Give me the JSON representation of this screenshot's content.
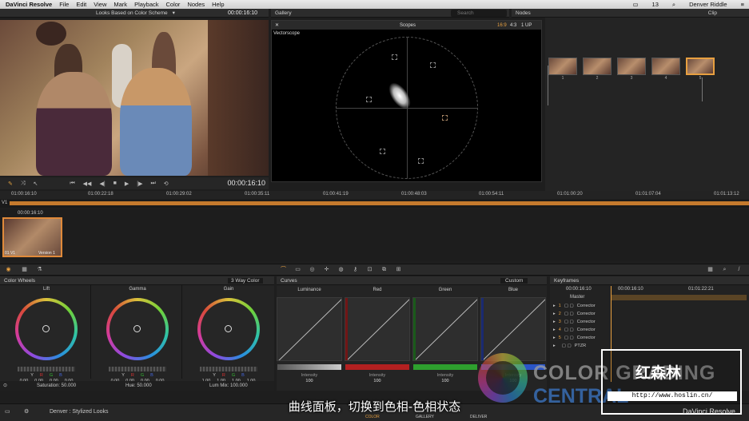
{
  "menubar": {
    "app": "DaVinci Resolve",
    "items": [
      "File",
      "Edit",
      "View",
      "Mark",
      "Playback",
      "Color",
      "Nodes",
      "Help"
    ],
    "battery": "13",
    "user": "Denver Riddle"
  },
  "viewer": {
    "selector": "Looks Based on Color Scheme",
    "timecode_top": "00:00:16:10",
    "timecode_bottom": "00:00:16:10"
  },
  "gallery": {
    "title": "Gallery",
    "search_placeholder": "Search"
  },
  "nodes_panel": {
    "title": "Nodes",
    "clip_label": "Clip",
    "node_labels": [
      "1",
      "2",
      "3",
      "4",
      "5"
    ]
  },
  "scopes": {
    "title": "Scopes",
    "ratio_169": "16:9",
    "ratio_43": "4:3",
    "layout": "1 UP",
    "scope_name": "Vectorscope"
  },
  "ruler": {
    "ticks": [
      "01:00:16:10",
      "01:00:22:18",
      "01:00:29:02",
      "01:00:35:11",
      "01:00:41:19",
      "01:00:48:03",
      "01:00:54:11",
      "01:01:00:20",
      "01:01:07:04",
      "01:01:13:12"
    ],
    "track": "V1"
  },
  "clip": {
    "timecode": "00:00:16:10",
    "label": "01 V1",
    "version": "Version 1"
  },
  "color_wheels": {
    "title": "Color Wheels",
    "mode": "3 Way Color",
    "wheels": [
      {
        "name": "Lift",
        "values": [
          "0.00",
          "0.00",
          "0.00",
          "0.00"
        ]
      },
      {
        "name": "Gamma",
        "values": [
          "0.00",
          "0.00",
          "0.00",
          "0.00"
        ]
      },
      {
        "name": "Gain",
        "values": [
          "1.00",
          "1.00",
          "1.00",
          "1.00"
        ]
      }
    ],
    "channels": [
      "Y",
      "R",
      "G",
      "B"
    ],
    "saturation": "Saturation: 50.000",
    "hue": "Hue: 50.000",
    "lum_mix": "Lum Mix: 100.000"
  },
  "curves": {
    "title": "Curves",
    "mode": "Custom",
    "channels": [
      {
        "name": "Luminance",
        "intensity": "100",
        "color": "#8a8a8a"
      },
      {
        "name": "Red",
        "intensity": "100",
        "color": "#b32020"
      },
      {
        "name": "Green",
        "intensity": "100",
        "color": "#2ea02e"
      },
      {
        "name": "Blue",
        "intensity": "100",
        "color": "#2a55c8"
      }
    ],
    "intensity_label": "Intensity"
  },
  "keyframes": {
    "title": "Keyframes",
    "tc_left": "00:00:16:10",
    "tc_mid": "00:00:16:10",
    "tc_right": "01:01:22:21",
    "master": "Master",
    "rows": [
      {
        "num": "1",
        "label": "Corrector"
      },
      {
        "num": "2",
        "label": "Corrector"
      },
      {
        "num": "3",
        "label": "Corrector"
      },
      {
        "num": "4",
        "label": "Corrector"
      },
      {
        "num": "5",
        "label": "Corrector"
      },
      {
        "num": "",
        "label": "PTZR"
      }
    ]
  },
  "bottombar": {
    "project": "Denver : Stylized Looks",
    "tab_color": "COLOR",
    "tab_gallery": "GALLERY",
    "tab_deliver": "DELIVER"
  },
  "subtitle": "曲线面板，切换到色相-色相状态",
  "watermark": {
    "line1": "COLOR GRADING",
    "line2": "CENTRAL",
    "cn": "红森林",
    "url": "http://www.hoslin.cn/",
    "logo": "DaVinci Resolve"
  }
}
